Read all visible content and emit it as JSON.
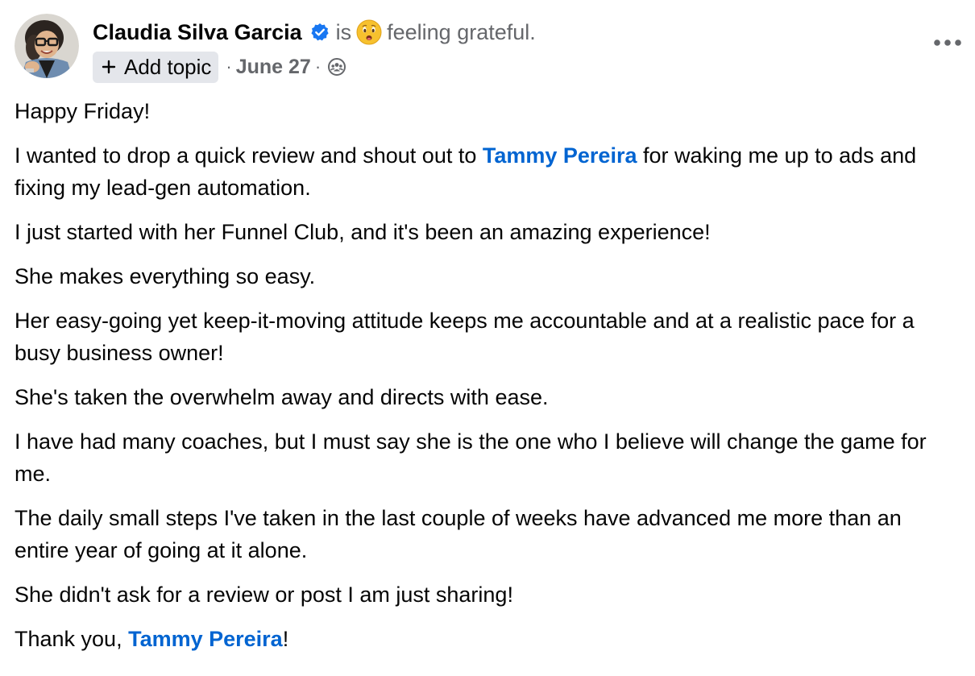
{
  "post": {
    "author": {
      "name": "Claudia Silva Garcia",
      "verified": true,
      "avatar_icon": "person-avatar-photo"
    },
    "feeling": {
      "prefix": "is",
      "emoji_icon": "grateful-face-emoji",
      "text": "feeling grateful."
    },
    "meta": {
      "add_topic_label": "Add topic",
      "separator": "·",
      "date": "June 27",
      "privacy_icon": "group-members-icon"
    },
    "more_icon": "more-options-icon",
    "body": {
      "p1": "Happy Friday!",
      "p2_before": "I wanted to drop a quick review and shout out to ",
      "p2_mention": "Tammy Pereira",
      "p2_after": " for waking me up to ads and fixing my lead-gen automation.",
      "p3": "I just started with her Funnel Club, and it's been an amazing experience!",
      "p4": "She makes everything so easy.",
      "p5": "Her easy-going yet keep-it-moving attitude keeps me accountable and at a realistic pace for a busy business owner!",
      "p6": "She's taken the overwhelm away and directs with ease.",
      "p7": "I have had many coaches, but I must say she is the one who I believe will change the game for me.",
      "p8": "The daily small steps I've taken in the last couple of weeks have advanced me more than an entire year of going at it alone.",
      "p9": "She didn't ask for a review or post I am just sharing!",
      "p10_before": "Thank you, ",
      "p10_mention": "Tammy Pereira",
      "p10_after": "!"
    },
    "colors": {
      "mention": "#0064d1",
      "verified_badge": "#1877f2",
      "secondary_text": "#65676b",
      "chip_background": "#e4e6eb"
    }
  }
}
